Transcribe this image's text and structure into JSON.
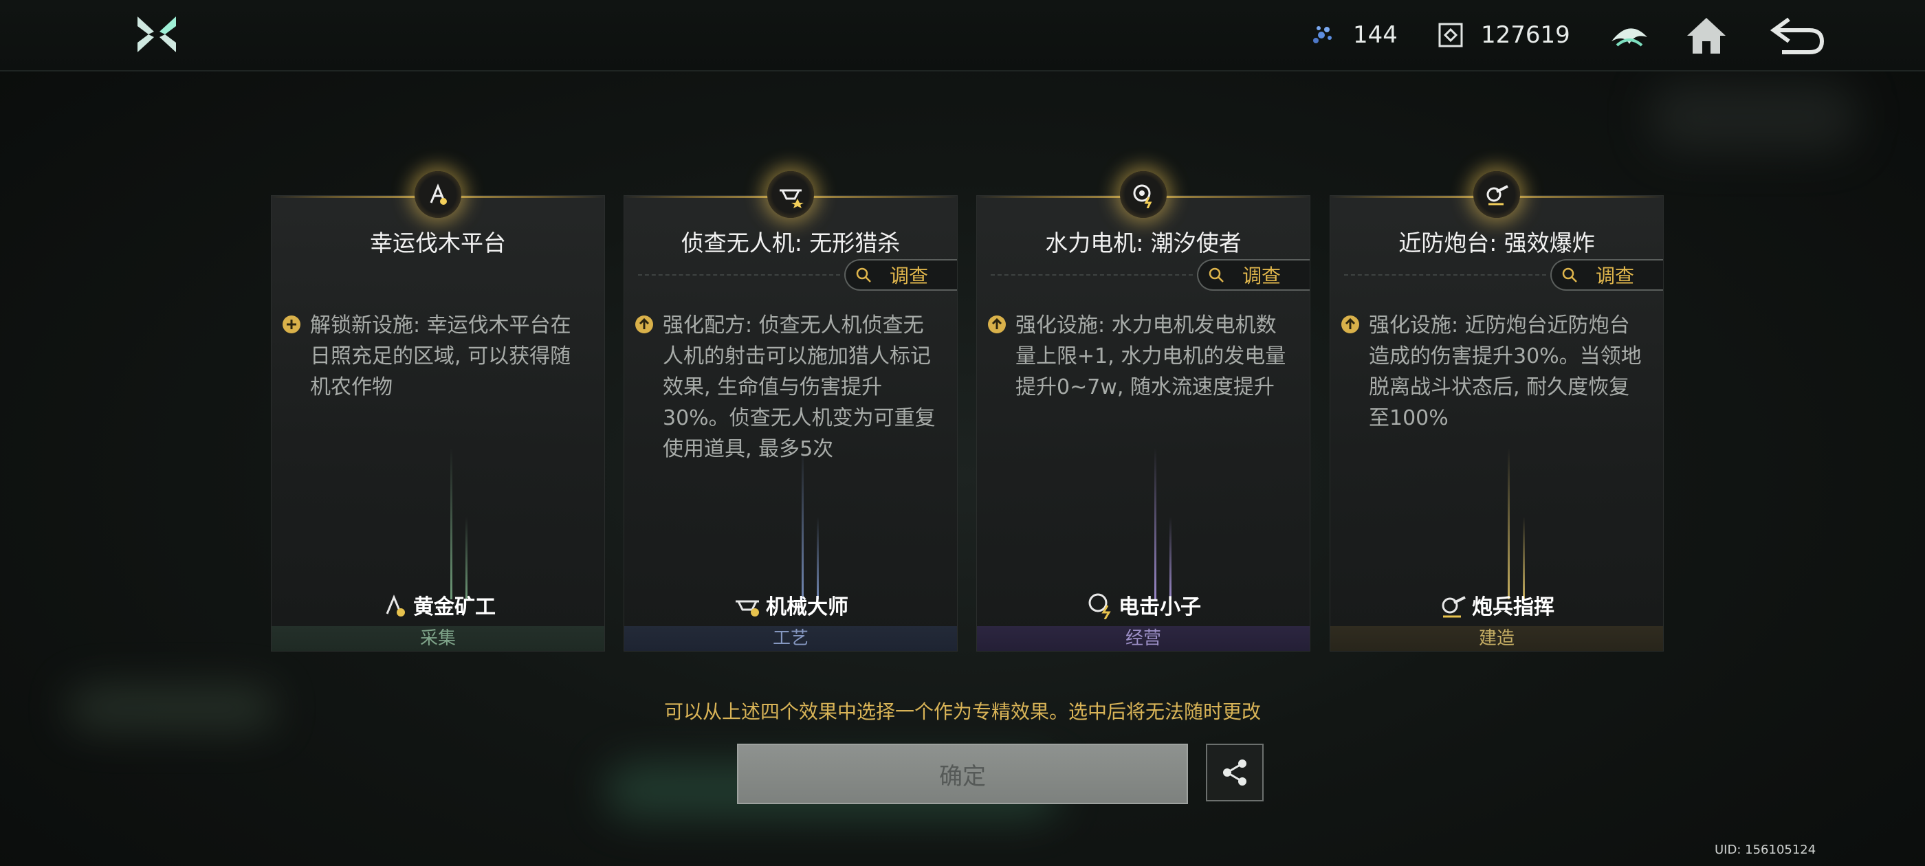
{
  "topbar": {
    "logo_icon": "game-logo-icon",
    "resource1": {
      "icon": "crystal-icon",
      "value": "144"
    },
    "resource2": {
      "icon": "chip-icon",
      "value": "127619"
    },
    "buttons": [
      "faction-icon",
      "home-icon",
      "back-icon"
    ]
  },
  "cards": [
    {
      "title": "幸运伐木平台",
      "has_inspect": false,
      "desc_icon": "plus-circle-icon",
      "desc": "解锁新设施: 幸运伐木平台在日照充足的区域, 可以获得随机农作物",
      "profession": "黄金矿工",
      "category": "采集",
      "accent": "#6e9a78"
    },
    {
      "title": "侦查无人机: 无形猎杀",
      "has_inspect": true,
      "inspect_label": "调查",
      "desc_icon": "upgrade-arrow-icon",
      "desc": "强化配方: 侦查无人机侦查无人机的射击可以施加猎人标记效果, 生命值与伤害提升30%。侦查无人机变为可重复使用道具, 最多5次",
      "profession": "机械大师",
      "category": "工艺",
      "accent": "#7288b4"
    },
    {
      "title": "水力电机: 潮汐使者",
      "has_inspect": true,
      "inspect_label": "调查",
      "desc_icon": "upgrade-arrow-icon",
      "desc": "强化设施: 水力电机发电机数量上限+1, 水力电机的发电量提升0~7w, 随水流速度提升",
      "profession": "电击小子",
      "category": "经营",
      "accent": "#9a88c8"
    },
    {
      "title": "近防炮台: 强效爆炸",
      "has_inspect": true,
      "inspect_label": "调查",
      "desc_icon": "upgrade-arrow-icon",
      "desc": "强化设施: 近防炮台近防炮台造成的伤害提升30%。当领地脱离战斗状态后, 耐久度恢复至100%",
      "profession": "炮兵指挥",
      "category": "建造",
      "accent": "#c8b060"
    }
  ],
  "hint": "可以从上述四个效果中选择一个作为专精效果。选中后将无法随时更改",
  "confirm_label": "确定",
  "uid": "UID: 156105124"
}
